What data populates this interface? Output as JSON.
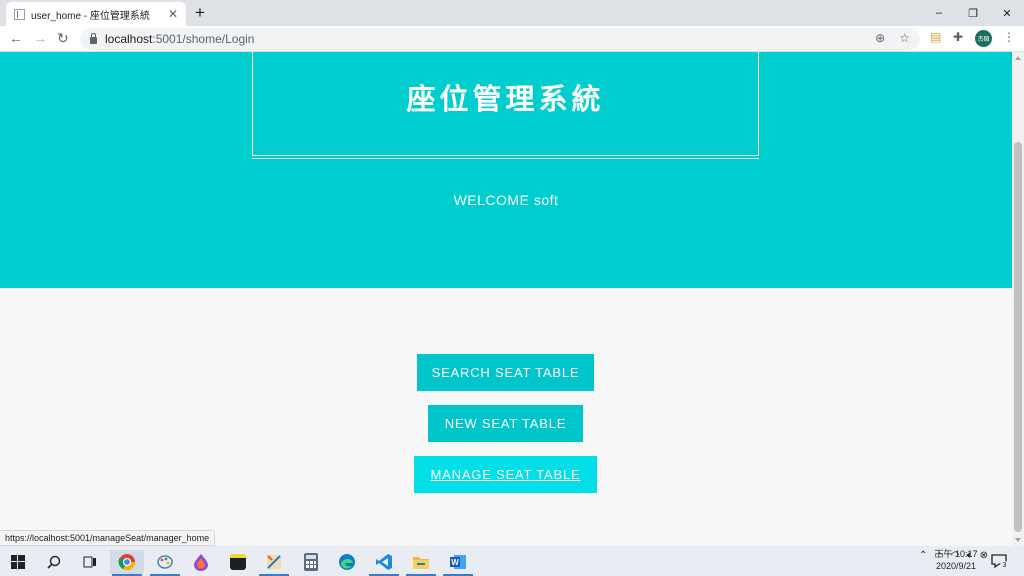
{
  "browser": {
    "tab_title": "user_home - 座位管理系統",
    "tab_close": "✕",
    "new_tab": "+",
    "window_controls": {
      "minimize": "–",
      "restore": "❐",
      "close": "✕"
    },
    "nav": {
      "back": "←",
      "forward": "→",
      "reload": "↻"
    },
    "url_host": "localhost",
    "url_path": ":5001/shome/Login",
    "profile_label": "杰碩",
    "status_url": "https://localhost:5001/manageSeat/manager_home"
  },
  "page": {
    "site_title": "座位管理系統",
    "welcome": "WELCOME soft",
    "buttons": {
      "search": "SEARCH SEAT TABLE",
      "new": "NEW SEAT TABLE",
      "manage": "MANAGE SEAT TABLE"
    }
  },
  "colors": {
    "hero": "#00cdcd",
    "button": "#00c6cc",
    "button_hover": "#03dfe8",
    "page_bg": "#f7f7f7"
  },
  "taskbar": {
    "apps": [
      "windows-start-icon",
      "search-icon",
      "task-view-icon",
      "chrome-icon",
      "paint-icon",
      "browser-icon",
      "sticky-notes-icon",
      "tool-icon",
      "calculator-icon",
      "edge-icon",
      "vscode-icon",
      "file-explorer-icon",
      "word-icon"
    ],
    "time": "下午 10:17",
    "date": "2020/9/21",
    "notification_count": "3"
  }
}
